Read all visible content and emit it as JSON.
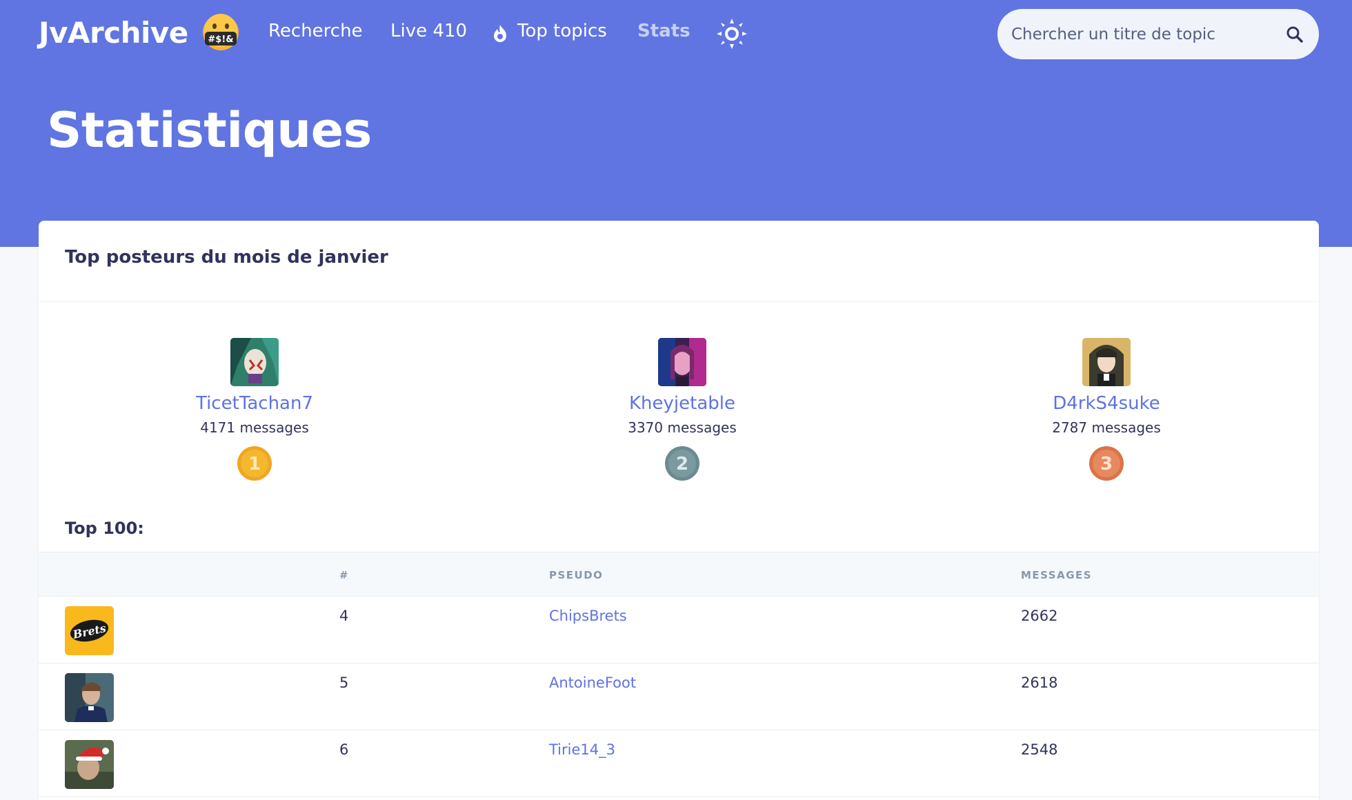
{
  "nav": {
    "brand": "JvArchive",
    "brand_badge": "#$!&",
    "links": [
      "Recherche",
      "Live 410",
      "Top topics",
      "Stats"
    ],
    "search_placeholder": "Chercher un titre de topic"
  },
  "page": {
    "title": "Statistiques"
  },
  "card": {
    "title": "Top posteurs du mois de janvier",
    "podium": [
      {
        "pseudo": "TicetTachan7",
        "count": "4171 messages",
        "rank": "1",
        "medal_color": "#f4b72e"
      },
      {
        "pseudo": "Kheyjetable",
        "count": "3370 messages",
        "rank": "2",
        "medal_color": "#7a9aa0"
      },
      {
        "pseudo": "D4rkS4suke",
        "count": "2787 messages",
        "rank": "3",
        "medal_color": "#e7895f"
      }
    ],
    "top100_label": "Top 100:",
    "columns": [
      "#",
      "PSEUDO",
      "MESSAGES"
    ],
    "rows": [
      {
        "rank": "4",
        "pseudo": "ChipsBrets",
        "messages": "2662",
        "avatar_text": "Brets"
      },
      {
        "rank": "5",
        "pseudo": "AntoineFoot",
        "messages": "2618"
      },
      {
        "rank": "6",
        "pseudo": "Tirie14_3",
        "messages": "2548"
      }
    ]
  },
  "colors": {
    "accent": "#6075e2",
    "link": "#5e72e4",
    "text": "#32325d"
  }
}
